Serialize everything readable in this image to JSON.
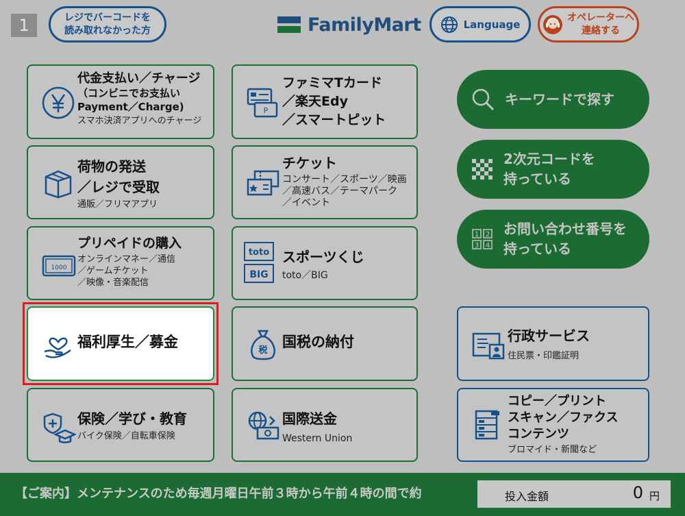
{
  "header": {
    "page_number": "1",
    "barcode_button": "レジでバーコードを\n読み取れなかった方",
    "logo_text": "FamilyMart",
    "language_button": "Language",
    "operator_button": "オペレーターへ\n連絡する"
  },
  "tiles": {
    "payment": {
      "title": "代金支払い／チャージ",
      "subtitle": "（コンビニでお支払い\nPayment／Charge)",
      "note": "スマホ決済アプリへのチャージ"
    },
    "famima_card": {
      "title": "ファミマTカード\n／楽天Edy\n／スマートピット"
    },
    "shipping": {
      "title": "荷物の発送\n／レジで受取",
      "note": "通販／フリマアプリ"
    },
    "ticket": {
      "title": "チケット",
      "note": "コンサート／スポーツ／映画\n／高速バス／テーマパーク\n／イベント"
    },
    "prepaid": {
      "title": "プリペイドの購入",
      "note": "オンラインマネー／通信\n／ゲームチケット\n／映像・音楽配信",
      "card_value": "1000"
    },
    "sports_lottery": {
      "title": "スポーツくじ",
      "note": "toto／BIG",
      "toto_label": "toto",
      "big_label": "BIG"
    },
    "welfare": {
      "title": "福利厚生／募金"
    },
    "national_tax": {
      "title": "国税の納付",
      "bag_label": "税"
    },
    "insurance": {
      "title": "保険／学び・教育",
      "note": "バイク保険／自転車保険"
    },
    "remittance": {
      "title": "国際送金",
      "note": "Western Union"
    },
    "admin": {
      "title": "行政サービス",
      "note": "住民票・印鑑証明"
    },
    "copy_print": {
      "title": "コピー／プリント\nスキャン／ファクス\nコンテンツ",
      "note": "ブロマイド・新聞など"
    }
  },
  "actions": {
    "keyword_search": "キーワードで探す",
    "qr_code": "2次元コードを\n持っている",
    "inquiry_number": "お問い合わせ番号を\n持っている"
  },
  "footer": {
    "ticker": "【ご案内】メンテナンスのため毎週月曜日午前３時から午前４時の間で約",
    "amount_label": "投入金額",
    "amount_value": "0",
    "amount_unit": "円"
  },
  "colors": {
    "green_border": "#1a6e36",
    "blue_border": "#14508a",
    "selection": "#e11b1b",
    "logo_blue": "#1f4e7a"
  }
}
